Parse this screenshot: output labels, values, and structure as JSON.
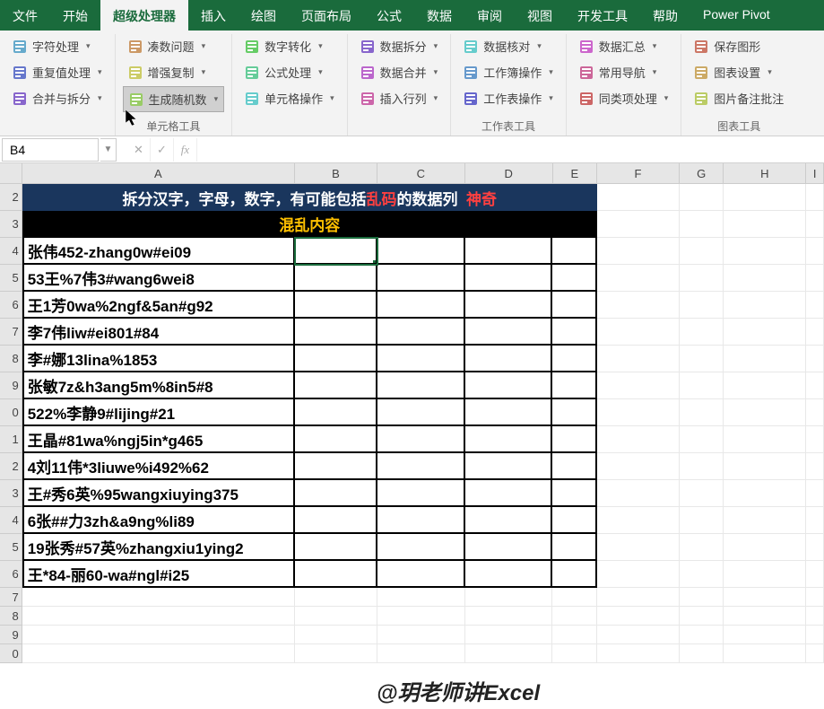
{
  "tabs": [
    "文件",
    "开始",
    "超级处理器",
    "插入",
    "绘图",
    "页面布局",
    "公式",
    "数据",
    "审阅",
    "视图",
    "开发工具",
    "帮助",
    "Power Pivot"
  ],
  "activeTab": 2,
  "ribbon": {
    "g1": [
      {
        "label": "字符处理",
        "dd": true
      },
      {
        "label": "重复值处理",
        "dd": true
      },
      {
        "label": "合并与拆分",
        "dd": true
      }
    ],
    "g2": [
      {
        "label": "凑数问题",
        "dd": true
      },
      {
        "label": "增强复制",
        "dd": true
      },
      {
        "label": "生成随机数",
        "dd": true,
        "hl": true
      }
    ],
    "g2label": "单元格工具",
    "g3": [
      {
        "label": "数字转化",
        "dd": true
      },
      {
        "label": "公式处理",
        "dd": true
      },
      {
        "label": "单元格操作",
        "dd": true
      }
    ],
    "g4": [
      {
        "label": "数据拆分",
        "dd": true
      },
      {
        "label": "数据合并",
        "dd": true
      },
      {
        "label": "插入行列",
        "dd": true
      }
    ],
    "g5": [
      {
        "label": "数据核对",
        "dd": true
      },
      {
        "label": "工作簿操作",
        "dd": true
      },
      {
        "label": "工作表操作",
        "dd": true
      }
    ],
    "g5label": "工作表工具",
    "g6": [
      {
        "label": "数据汇总",
        "dd": true
      },
      {
        "label": "常用导航",
        "dd": true
      },
      {
        "label": "同类项处理",
        "dd": true
      }
    ],
    "g7": [
      {
        "label": "保存图形"
      },
      {
        "label": "图表设置",
        "dd": true
      },
      {
        "label": "图片备注批注"
      }
    ],
    "g7label": "图表工具"
  },
  "namebox": "B4",
  "columns": [
    "A",
    "B",
    "C",
    "D",
    "E",
    "F",
    "G",
    "H",
    "I"
  ],
  "title": {
    "pre": "拆分汉字，字母，数字，有可能包括",
    "red1": "乱码",
    "mid": "的数据列",
    "red2": "神奇"
  },
  "header": "混乱内容",
  "rows": [
    "张伟452-zhang0w#ei09",
    "53王%7伟3#wang6wei8",
    "王1芳0wa%2ngf&5an#g92",
    "李7伟liw#ei801#84",
    "李#娜13lina%1853",
    "张敏7z&h3ang5m%8in5#8",
    "522%李静9#lijing#21",
    "王晶#81wa%ngj5in*g465",
    "4刘11伟*3liuwe%i492%62",
    "王#秀6英%95wangxiuying375",
    "6张##力3zh&a9ng%li89",
    "19张秀#57英%zhangxiu1ying2",
    "王*84-丽60-wa#ngl#i25"
  ],
  "rowNums": [
    "2",
    "3",
    "4",
    "5",
    "6",
    "7",
    "8",
    "9",
    "0",
    "1",
    "2",
    "3",
    "4",
    "5",
    "6",
    "7",
    "8",
    "9",
    "0"
  ],
  "watermark": "@玥老师讲Excel"
}
